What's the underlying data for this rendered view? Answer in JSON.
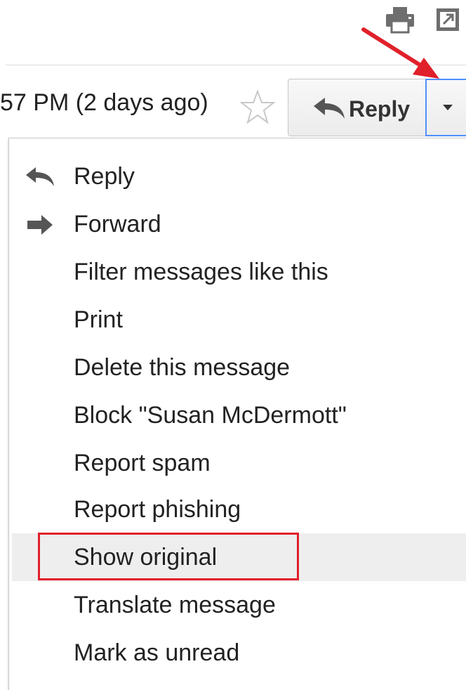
{
  "toolbar": {
    "print_icon": "print-icon",
    "popout_icon": "new-window-icon"
  },
  "message_header": {
    "timestamp": "57 PM (2 days ago)",
    "star_icon": "star-outline-icon"
  },
  "reply_group": {
    "reply_label": "Reply",
    "reply_icon": "reply-arrow-icon",
    "more_icon": "chevron-down-icon",
    "focus_color": "#4d90fe"
  },
  "annotation": {
    "arrow_color": "#e0202a",
    "highlight_color": "#e0202a"
  },
  "menu": {
    "items": [
      {
        "label": "Reply",
        "icon": "reply-arrow-icon"
      },
      {
        "label": "Forward",
        "icon": "forward-arrow-icon"
      },
      {
        "label": "Filter messages like this"
      },
      {
        "label": "Print"
      },
      {
        "label": "Delete this message"
      },
      {
        "label": "Block \"Susan McDermott\""
      },
      {
        "label": "Report spam"
      },
      {
        "label": "Report phishing"
      },
      {
        "label": "Show original",
        "highlighted": true
      },
      {
        "label": "Translate message"
      },
      {
        "label": "Mark as unread"
      }
    ]
  }
}
